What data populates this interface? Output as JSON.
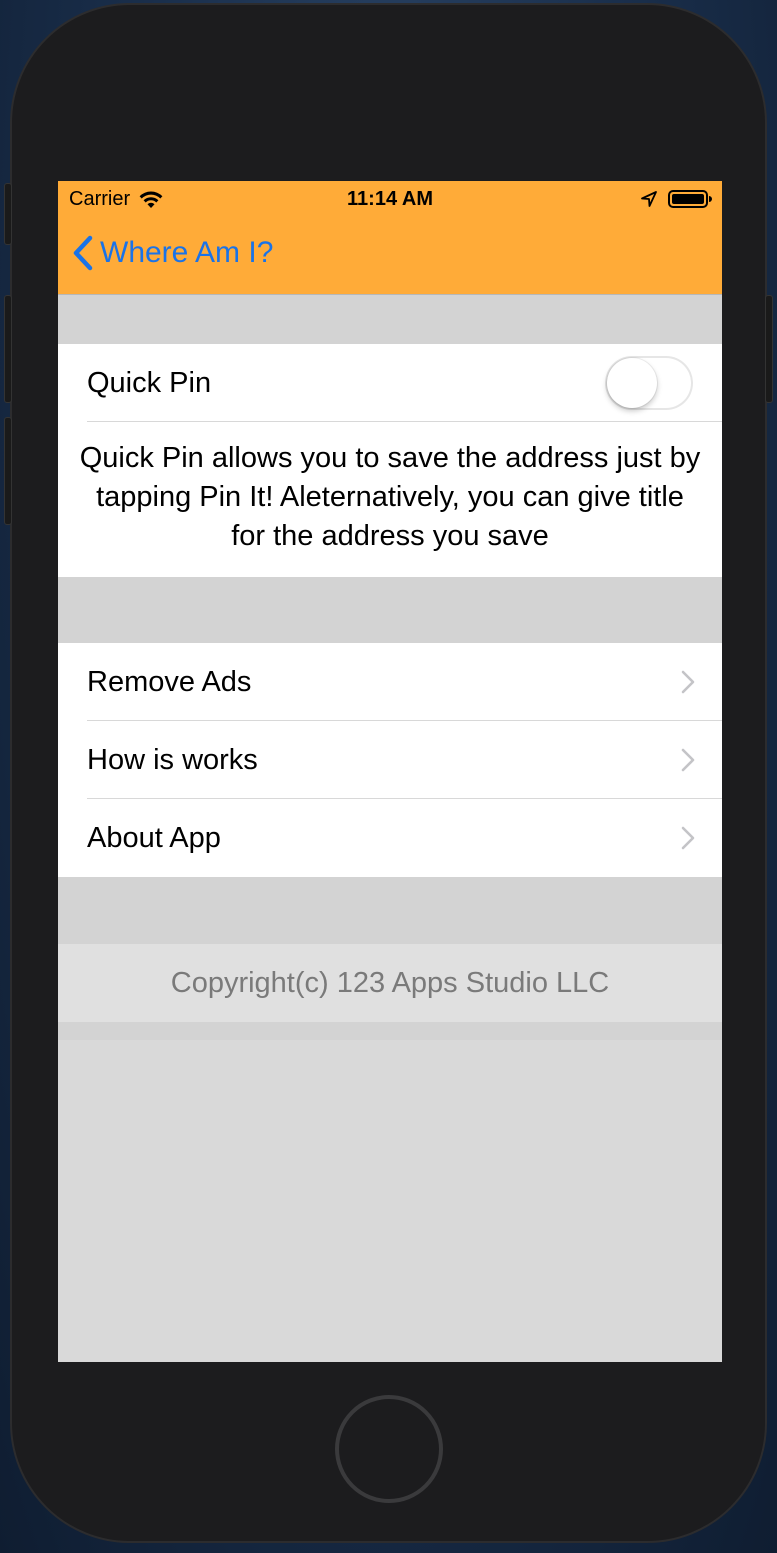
{
  "status_bar": {
    "carrier": "Carrier",
    "time": "11:14 AM"
  },
  "nav": {
    "back_label": "Where Am I?",
    "bar_color": "#ffab38",
    "tint_color": "#1a73e8"
  },
  "quick_pin": {
    "label": "Quick Pin",
    "enabled": false,
    "description": "Quick Pin allows you to save the address just by tapping Pin It! Aleternatively, you can give title for the address you save"
  },
  "menu": {
    "items": [
      {
        "label": "Remove Ads",
        "icon": "chevron-right-icon"
      },
      {
        "label": "How is works",
        "icon": "chevron-right-icon"
      },
      {
        "label": "About App",
        "icon": "chevron-right-icon"
      }
    ]
  },
  "footer": {
    "copyright": "Copyright(c) 123 Apps Studio LLC"
  },
  "icons": {
    "status": [
      "wifi-icon",
      "location-icon",
      "battery-icon"
    ],
    "back": "chevron-left-icon"
  }
}
